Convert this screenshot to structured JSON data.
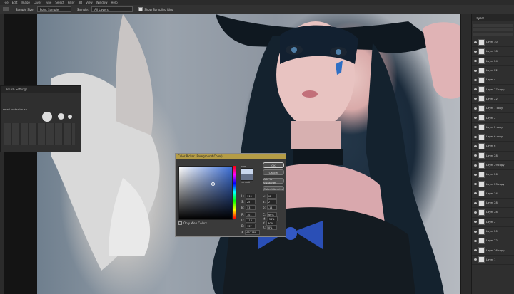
{
  "menubar": {
    "items": [
      "File",
      "Edit",
      "Image",
      "Layer",
      "Type",
      "Select",
      "Filter",
      "3D",
      "View",
      "Window",
      "Help"
    ]
  },
  "options": {
    "sample_size": "Sample Size:",
    "sample_size_value": "Point Sample",
    "sample_label": "Sample:",
    "sample_value": "All Layers",
    "show_ring": "Show Sampling Ring"
  },
  "brush_panel": {
    "title": "Brush Settings",
    "preset_label": "small water brush"
  },
  "layers": {
    "tab": "Layers",
    "items": [
      "Layer 30",
      "Layer 18",
      "Layer 24",
      "Layer 22",
      "Layer 4",
      "Layer 27 copy",
      "Layer 22",
      "Layer 7 copy",
      "Layer 2",
      "Layer 2 copy",
      "Layer 6 copy",
      "Layer 6",
      "Layer 28",
      "Layer 29 copy",
      "Layer 26",
      "Layer 23 copy",
      "Layer 34",
      "Layer 28",
      "Layer 28",
      "Layer 2",
      "Layer 20",
      "Layer 22",
      "Layer 26 copy",
      "Layer 1"
    ]
  },
  "picker": {
    "title": "Color Picker (Foreground Color)",
    "ok": "OK",
    "cancel": "Cancel",
    "add": "Add to Swatches",
    "libraries": "Color Libraries",
    "new": "new",
    "current": "current",
    "only_web": "Only Web Colors",
    "hsb": [
      {
        "l": "H:",
        "v": "219"
      },
      {
        "l": "S:",
        "v": "25"
      },
      {
        "l": "B:",
        "v": "53"
      }
    ],
    "rgb": [
      {
        "l": "R:",
        "v": "101"
      },
      {
        "l": "G:",
        "v": "113"
      },
      {
        "l": "B:",
        "v": "137"
      }
    ],
    "lab": [
      {
        "l": "L:",
        "v": "48"
      },
      {
        "l": "a:",
        "v": "2"
      },
      {
        "l": "b:",
        "v": "-14"
      }
    ],
    "cmyk": [
      {
        "l": "C:",
        "v": "66%"
      },
      {
        "l": "M:",
        "v": "54%"
      },
      {
        "l": "Y:",
        "v": "30%"
      },
      {
        "l": "K:",
        "v": "8%"
      }
    ],
    "hex_label": "#",
    "hex": "657189",
    "colors": {
      "new": "#c9d7ee",
      "current": "#657189",
      "accent": "#b49c46"
    }
  }
}
